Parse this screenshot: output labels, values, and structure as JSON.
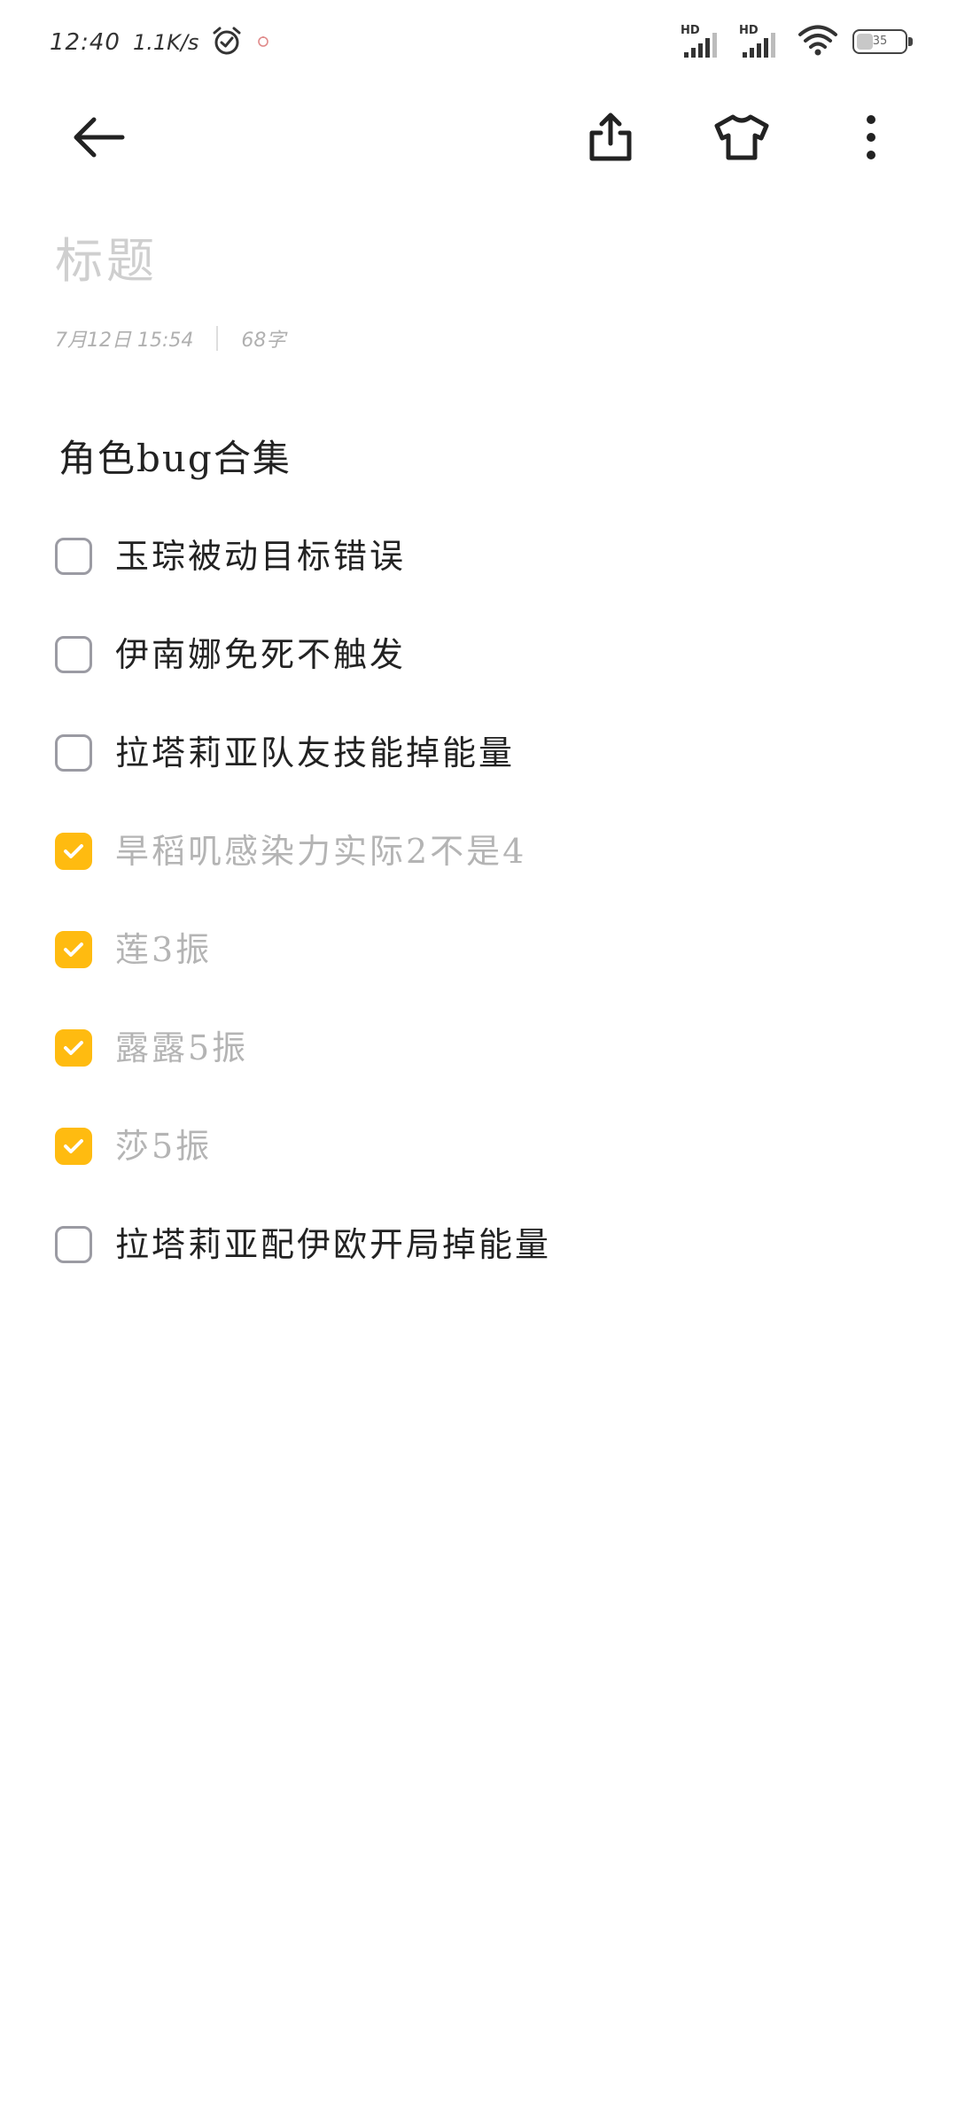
{
  "status_bar": {
    "time": "12:40",
    "network_speed": "1.1K/s",
    "alarm_icon": "alarm-clock-icon",
    "signal_1_label": "HD",
    "signal_2_label": "HD",
    "battery_level": "35",
    "battery_fraction": 0.35
  },
  "toolbar": {
    "back_icon": "arrow-left-icon",
    "share_icon": "share-icon",
    "theme_icon": "tshirt-icon",
    "more_icon": "more-vertical-icon"
  },
  "note": {
    "title_placeholder": "标题",
    "date": "7月12日  15:54",
    "char_count": "68字",
    "heading": "角色bug合集",
    "items": [
      {
        "text": "玉琮被动目标错误",
        "checked": false
      },
      {
        "text": "伊南娜免死不触发",
        "checked": false
      },
      {
        "text": "拉塔莉亚队友技能掉能量",
        "checked": false
      },
      {
        "text": "旱稻叽感染力实际2不是4",
        "checked": true
      },
      {
        "text": "莲3振",
        "checked": true
      },
      {
        "text": "露露5振",
        "checked": true
      },
      {
        "text": "莎5振",
        "checked": true
      },
      {
        "text": "拉塔莉亚配伊欧开局掉能量",
        "checked": false
      }
    ]
  },
  "colors": {
    "accent": "#ffbb10",
    "checkbox_border": "#9b9ba3",
    "done_text": "#b4b4b4",
    "placeholder": "#cfcfcf"
  }
}
